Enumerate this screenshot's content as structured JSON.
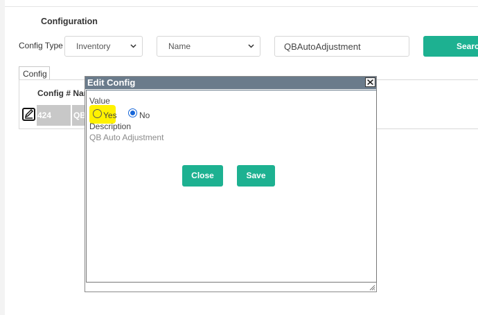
{
  "page": {
    "title": "Configuration"
  },
  "filters": {
    "type_label": "Config Type",
    "type_value": "Inventory",
    "field_value": "Name",
    "search_value": "QBAutoAdjustment",
    "search_button": "Search"
  },
  "tabs": {
    "config": "Config"
  },
  "grid": {
    "header": "Config # Name",
    "row": {
      "id": "424",
      "name": "QB"
    }
  },
  "dialog": {
    "title": "Edit Config",
    "value_label": "Value",
    "options": {
      "yes": "Yes",
      "no": "No",
      "selected": "No"
    },
    "description_label": "Description",
    "description_value": "QB Auto Adjustment",
    "close_button": "Close",
    "save_button": "Save"
  },
  "colors": {
    "accent": "#1db191",
    "titlebar": "#6a7b8b",
    "highlight": "#fff200",
    "radio_selected": "#1565d8"
  }
}
